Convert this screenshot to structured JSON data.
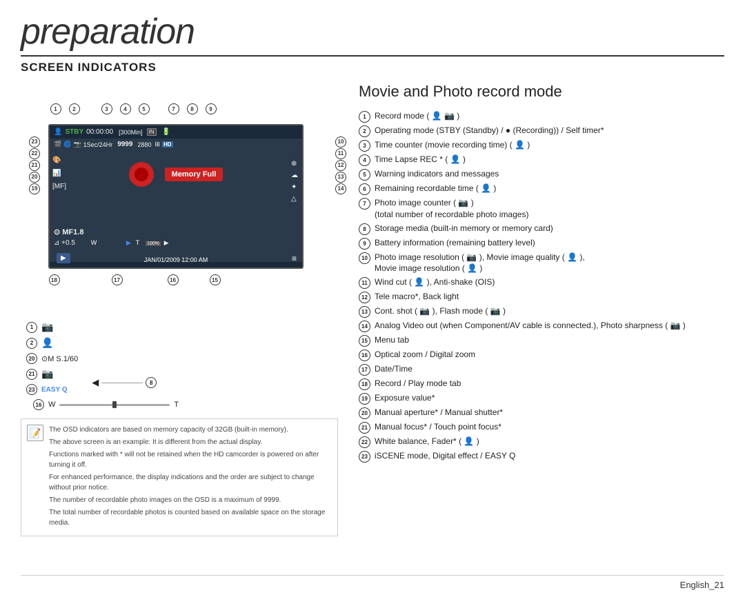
{
  "page": {
    "title": "preparation",
    "section": "SCREEN INDICATORS",
    "subtitle": "Movie and Photo record mode",
    "language": "English",
    "page_number": "_21"
  },
  "camera_screen": {
    "stby": "STBY",
    "timecode": "00:00:00",
    "bracket_info": "[300Min]",
    "in_label": "IN",
    "row2": "1Sec/24Hr  9999  2880",
    "memory_full": "Memory Full",
    "aperture": "MF1.8",
    "exposure": "+0.5",
    "date_time": "JAN/01/2009 12:00 AM",
    "play_btn": "▶",
    "menu_btn": "≡",
    "hd_label": "HD",
    "res_label": "100%"
  },
  "below_diagram": {
    "col1": [
      {
        "num": "1",
        "text": "📷"
      },
      {
        "num": "2",
        "text": ""
      },
      {
        "num": "20",
        "text": ""
      },
      {
        "num": "21",
        "text": ""
      },
      {
        "num": "23",
        "text": "EASY Q"
      }
    ],
    "zoom_w": "W",
    "zoom_t": "T",
    "arrow_8": "◀"
  },
  "indicators": [
    {
      "num": "1",
      "text": "Record mode (  )"
    },
    {
      "num": "2",
      "text": "Operating mode (STBY (Standby) / ● (Recording)) / Self timer*"
    },
    {
      "num": "3",
      "text": "Time counter (movie recording time) ( )"
    },
    {
      "num": "4",
      "text": "Time Lapse REC * ( )"
    },
    {
      "num": "5",
      "text": "Warning indicators and messages"
    },
    {
      "num": "6",
      "text": "Remaining recordable time ( )"
    },
    {
      "num": "7",
      "text": "Photo image counter ( )\n(total number of recordable photo images)"
    },
    {
      "num": "8",
      "text": "Storage media (built-in memory or memory card)"
    },
    {
      "num": "9",
      "text": "Battery information (remaining battery level)"
    },
    {
      "num": "10",
      "text": "Photo image resolution ( ), Movie image quality ( ),\nMovie image resolution ( )"
    },
    {
      "num": "11",
      "text": "Wind cut ( ), Anti-shake (OIS)"
    },
    {
      "num": "12",
      "text": "Tele macro*, Back light"
    },
    {
      "num": "13",
      "text": "Cont. shot ( ), Flash mode ( )"
    },
    {
      "num": "14",
      "text": "Analog Video out (when Component/AV cable is connected.), Photo sharpness ( )"
    },
    {
      "num": "15",
      "text": "Menu tab"
    },
    {
      "num": "16",
      "text": "Optical zoom / Digital zoom"
    },
    {
      "num": "17",
      "text": "Date/Time"
    },
    {
      "num": "18",
      "text": "Record / Play mode tab"
    },
    {
      "num": "19",
      "text": "Exposure value*"
    },
    {
      "num": "20",
      "text": "Manual aperture* / Manual shutter*"
    },
    {
      "num": "21",
      "text": "Manual focus* / Touch point focus*"
    },
    {
      "num": "22",
      "text": "White balance, Fader* ( )"
    },
    {
      "num": "23",
      "text": "iSCENE mode, Digital effect / EASY Q"
    }
  ],
  "notes": [
    "The OSD indicators are based on memory capacity of 32GB (built-in memory).",
    "The above screen is an example: It is different from the actual display.",
    "Functions marked with * will not be retained when the HD camcorder is powered on after turning it off.",
    "For enhanced performance, the display indications and the order are subject to change without prior notice.",
    "The number of recordable photo images on the OSD is a maximum of 9999.",
    "The total number of recordable photos is counted based on available space on the storage media."
  ]
}
